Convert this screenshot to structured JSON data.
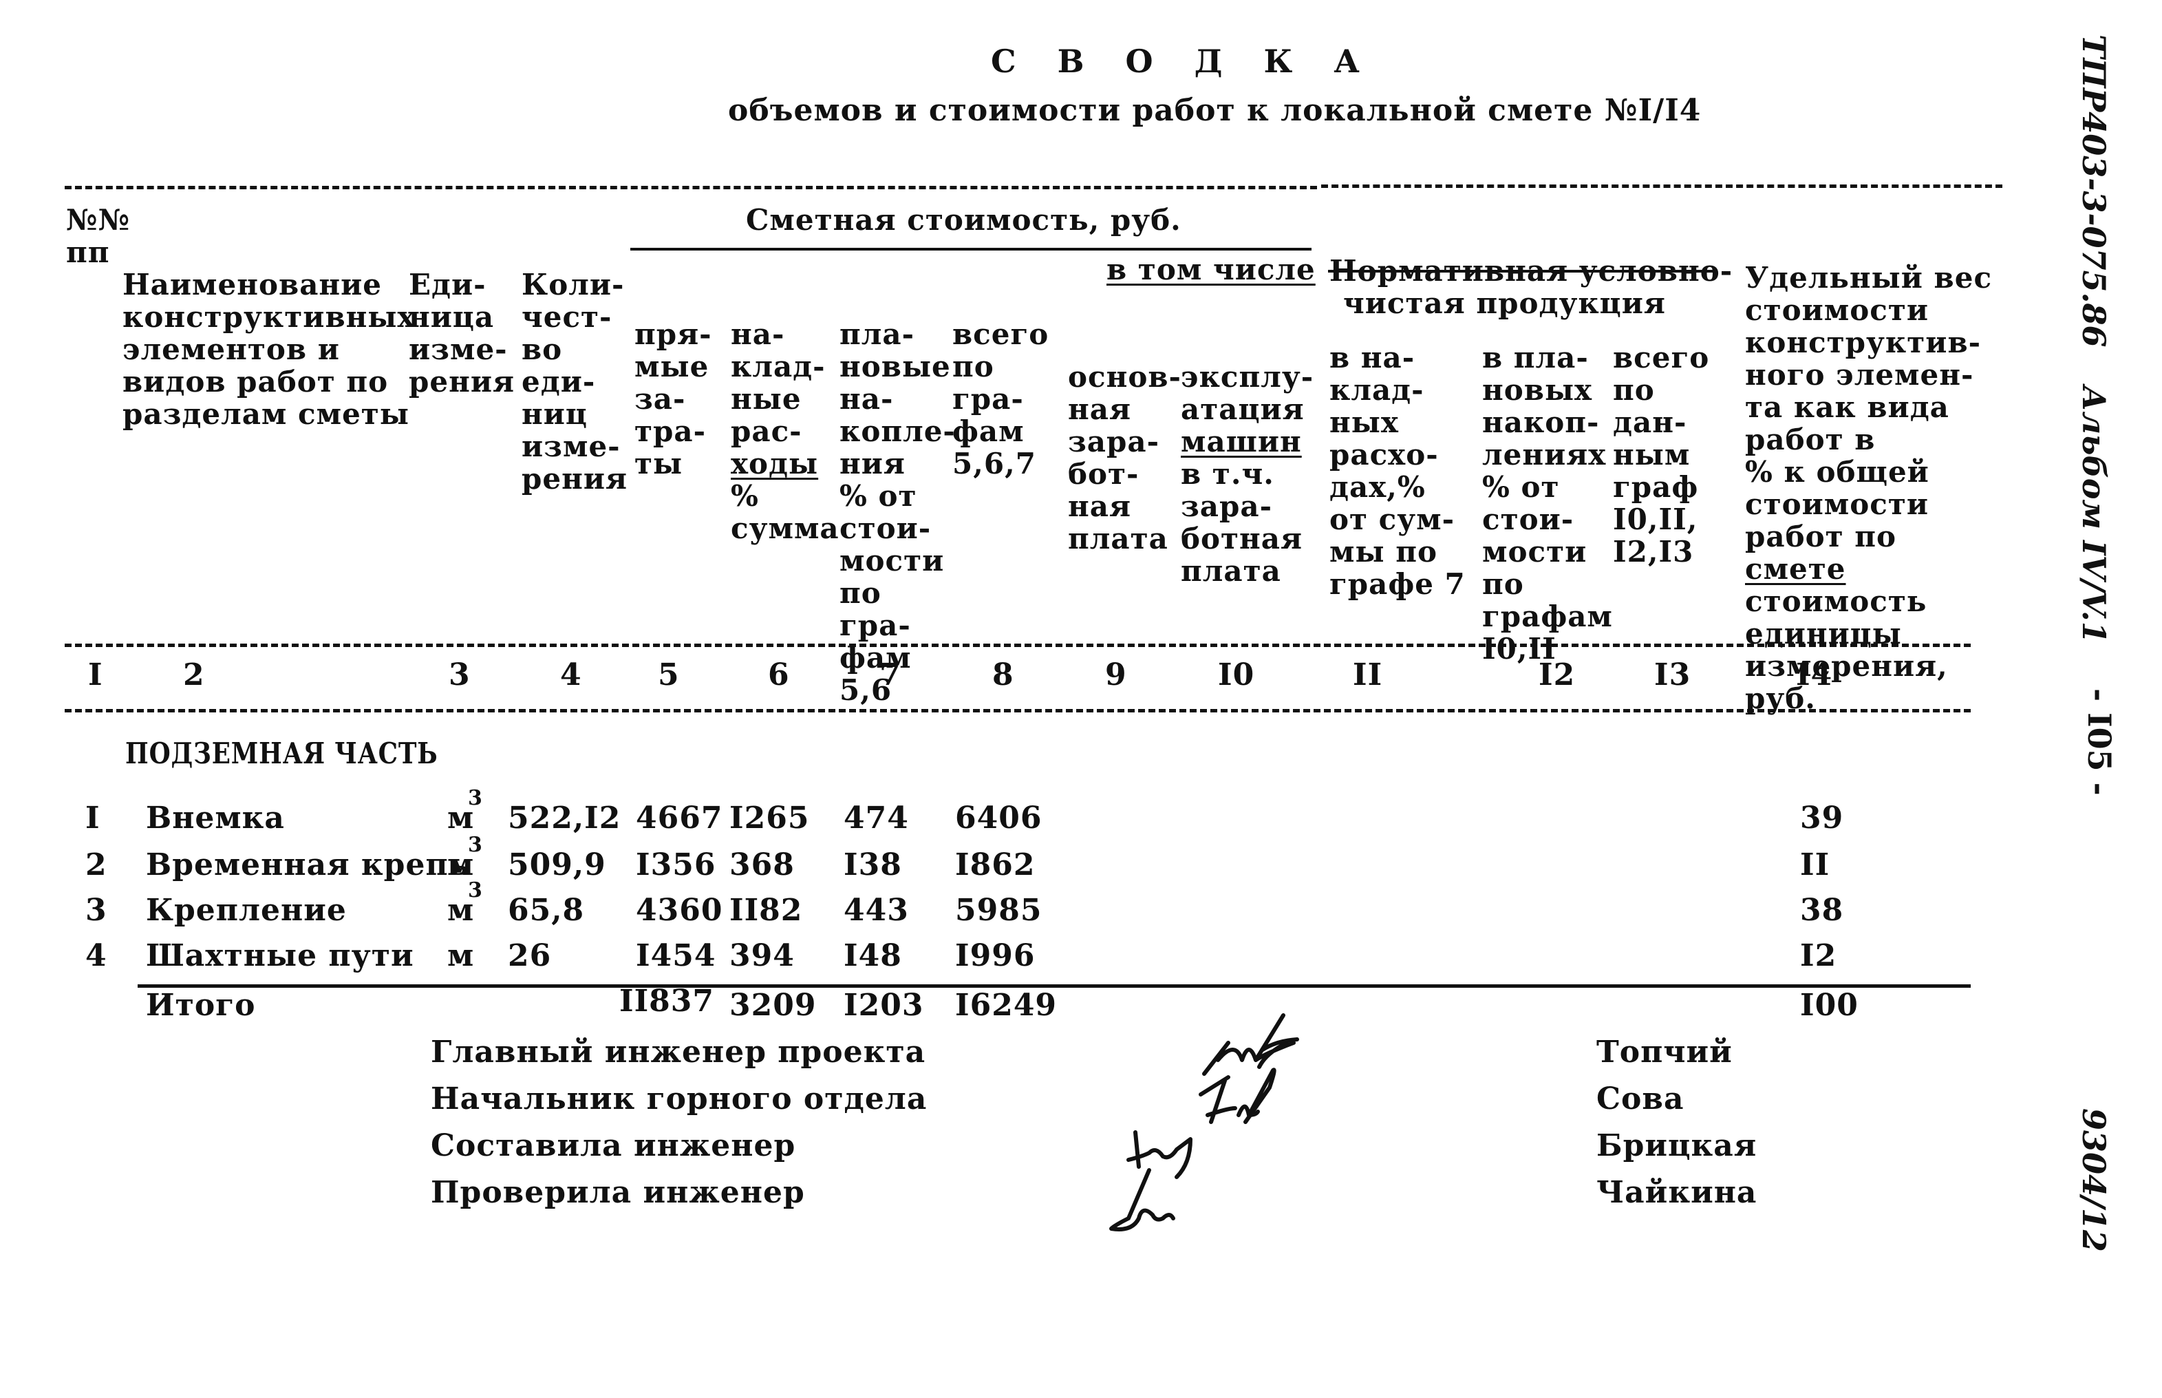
{
  "document": {
    "title": "С В О Д К А",
    "subtitle": "объемов и стоимости работ к локальной смете №I/I4"
  },
  "margin": {
    "code": "ТПР403-3-075.86",
    "album": "Альбом IV/V.1",
    "page": "- I05 -",
    "inventory": "9304/12"
  },
  "header": {
    "col1": [
      "№№",
      "пп"
    ],
    "col2": [
      "Наименование",
      "конструктивных",
      "элементов и",
      "видов работ по",
      "разделам сметы"
    ],
    "col3": [
      "Еди-",
      "ница",
      "изме-",
      "рения"
    ],
    "col4": [
      "Коли-",
      "чест-",
      "во",
      "еди-",
      "ниц",
      "изме-",
      "рения"
    ],
    "cost_group": "Сметная стоимость, руб.",
    "col5": [
      "пря-",
      "мые",
      "за-",
      "тра-",
      "ты"
    ],
    "col6": [
      "на-",
      "клад-",
      "ные",
      "рас-",
      "ходы",
      "%",
      "сумма"
    ],
    "col7": [
      "пла-",
      "новые",
      "на-",
      "копле-",
      "ния",
      "% от",
      "стои-",
      "мости",
      "по",
      "гра-",
      "фам",
      "5,6"
    ],
    "col8": [
      "всего",
      "по",
      "гра-",
      "фам",
      "5,6,7"
    ],
    "including": "в том числе",
    "col9": [
      "основ-",
      "ная",
      "зара-",
      "бот-",
      "ная",
      "плата"
    ],
    "col10": [
      "эксплу-",
      "атация",
      "машин",
      "в т.ч.",
      "зара-",
      "ботная",
      "плата"
    ],
    "norm_group": [
      "Нормативная условно-",
      "чистая продукция"
    ],
    "col11": [
      "в на-",
      "клад-",
      "ных",
      "расхо-",
      "дах,%",
      "от сум-",
      "мы по",
      "графе 7"
    ],
    "col12": [
      "в пла-",
      "новых",
      "накоп-",
      "лениях",
      "% от",
      "стои-",
      "мости",
      "по",
      "графам",
      "I0,II"
    ],
    "col13": [
      "всего",
      "по",
      "дан-",
      "ным",
      "граф",
      "I0,II,",
      "I2,I3"
    ],
    "col14": [
      "Удельный вес",
      "стоимости",
      "конструктив-",
      "ного элемен-",
      "та как вида",
      "работ в",
      "% к общей",
      "стоимости",
      "работ по",
      "смете",
      "стоимость",
      "единицы",
      "измерения,",
      "руб."
    ]
  },
  "column_numbers": [
    "I",
    "2",
    "3",
    "4",
    "5",
    "6",
    "7",
    "8",
    "9",
    "I0",
    "II",
    "I2",
    "I3",
    "I4"
  ],
  "section_title": "ПОДЗЕМНАЯ ЧАСТЬ",
  "rows": [
    {
      "num": "I",
      "name": "Внемка",
      "unit": "м",
      "unit_sup": "3",
      "qty": "522,I2",
      "direct": "4667",
      "overhead": "I265",
      "planned": "474",
      "total": "6406",
      "share": "39"
    },
    {
      "num": "2",
      "name": "Временная крепь",
      "unit": "м",
      "unit_sup": "3",
      "qty": "509,9",
      "direct": "I356",
      "overhead": "368",
      "planned": "I38",
      "total": "I862",
      "share": "II"
    },
    {
      "num": "3",
      "name": "Крепление",
      "unit": "м",
      "unit_sup": "3",
      "qty": "65,8",
      "direct": "4360",
      "overhead": "II82",
      "planned": "443",
      "total": "5985",
      "share": "38"
    },
    {
      "num": "4",
      "name": "Шахтные пути",
      "unit": "м",
      "unit_sup": "",
      "qty": "26",
      "direct": "I454",
      "overhead": "394",
      "planned": "I48",
      "total": "I996",
      "share": "I2"
    }
  ],
  "totals": {
    "label": "Итого",
    "direct": "II837",
    "overhead": "3209",
    "planned": "I203",
    "total": "I6249",
    "share": "I00"
  },
  "signatures": [
    {
      "role": "Главный инженер проекта",
      "name": "Топчий"
    },
    {
      "role": "Начальник горного отдела",
      "name": "Сова"
    },
    {
      "role": "Составила инженер",
      "name": "Брицкая"
    },
    {
      "role": "Проверила инженер",
      "name": "Чайкина"
    }
  ]
}
